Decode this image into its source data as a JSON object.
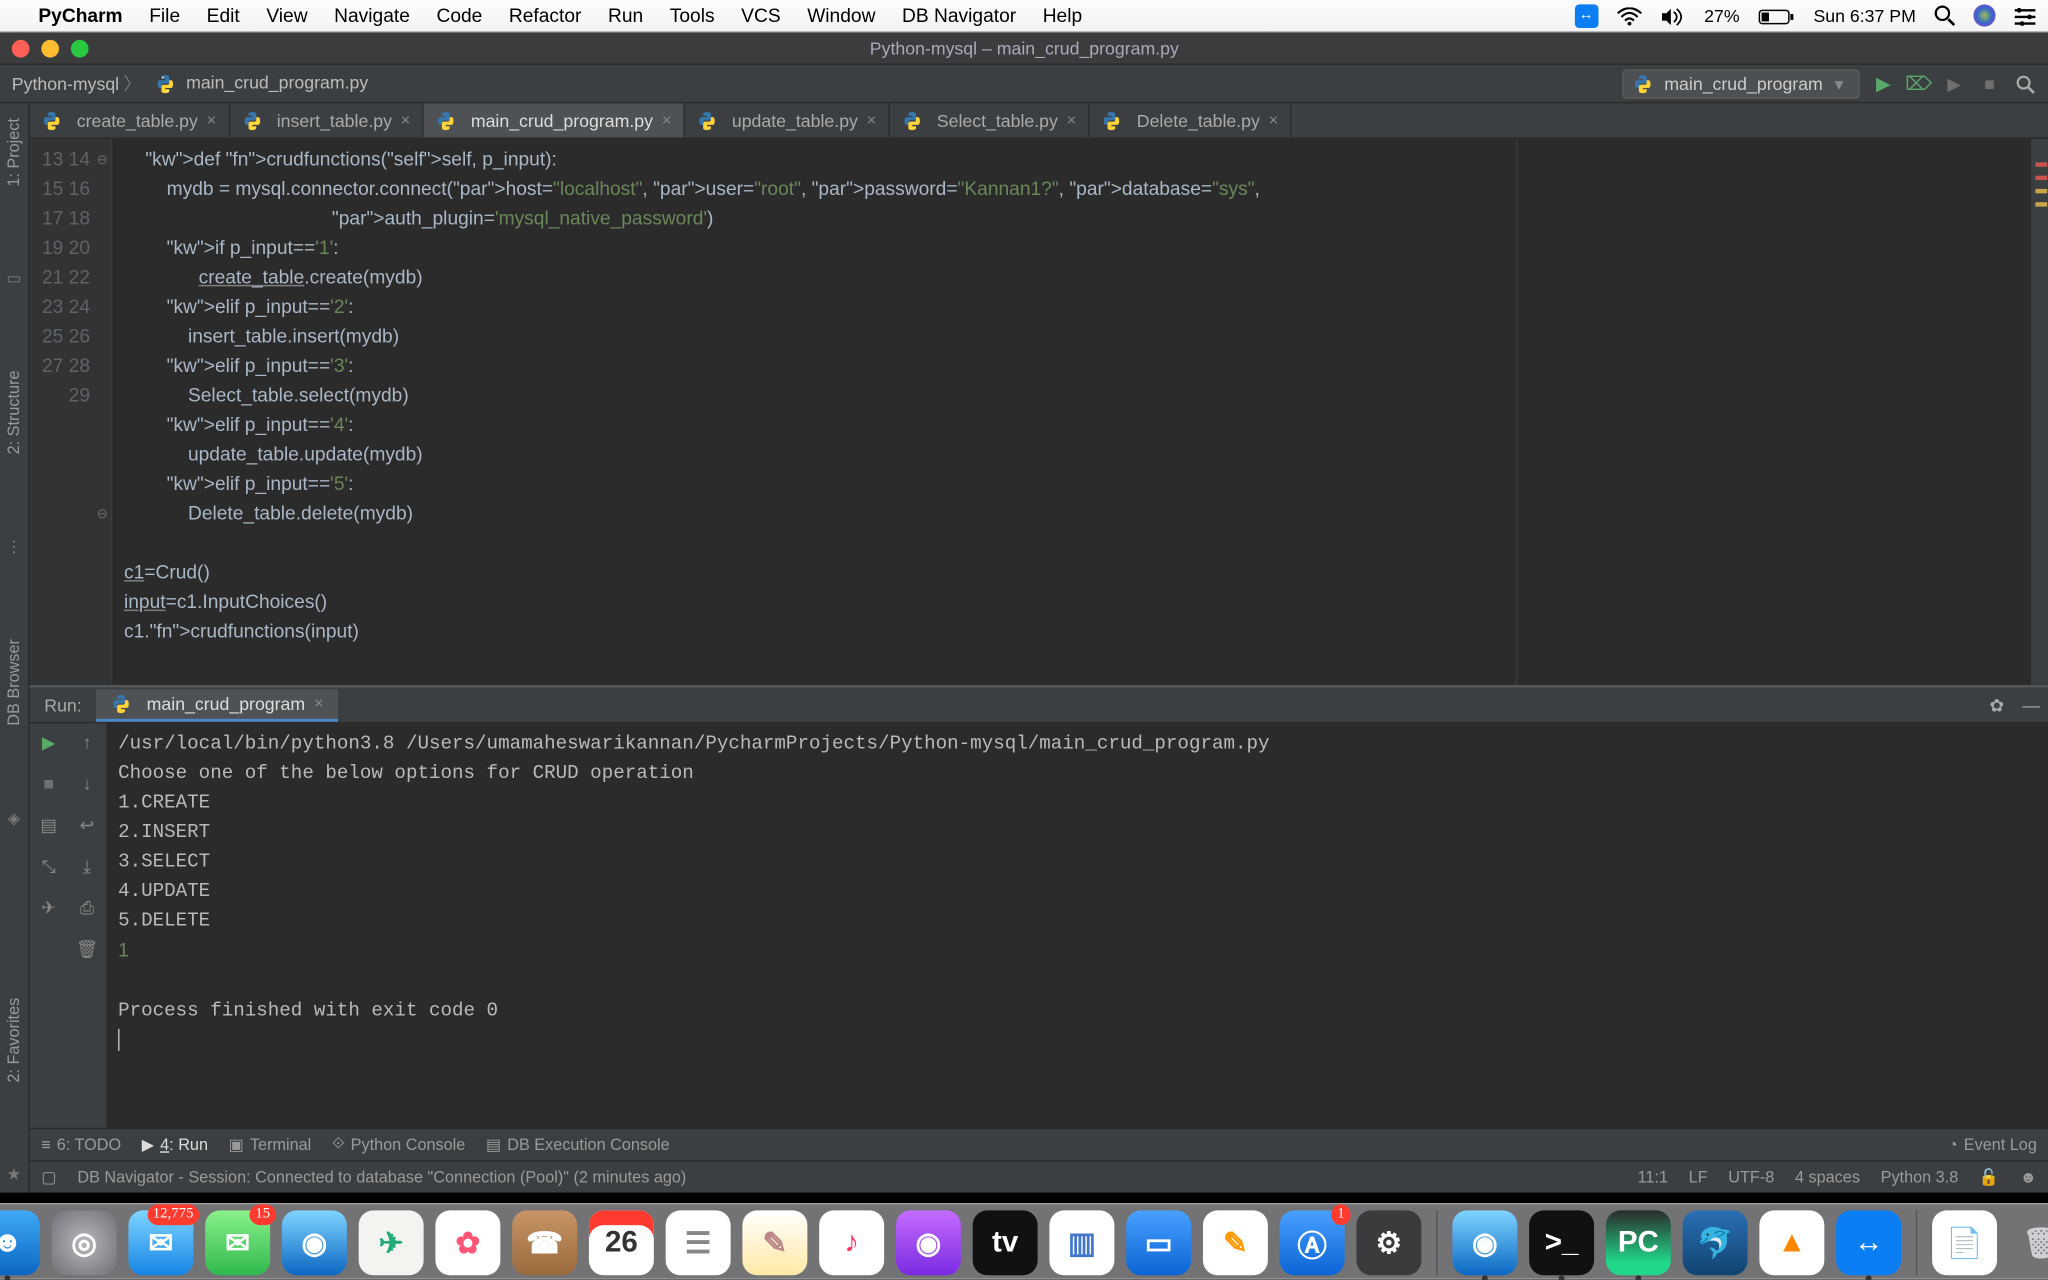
{
  "mac": {
    "app": "PyCharm",
    "menus": [
      "File",
      "Edit",
      "View",
      "Navigate",
      "Code",
      "Refactor",
      "Run",
      "Tools",
      "VCS",
      "Window",
      "DB Navigator",
      "Help"
    ],
    "battery_pct": "27%",
    "clock": "Sun 6:37 PM"
  },
  "window": {
    "title": "Python-mysql – main_crud_program.py",
    "breadcrumb_project": "Python-mysql",
    "breadcrumb_file": "main_crud_program.py",
    "run_config": "main_crud_program"
  },
  "left_tabs": [
    "1: Project",
    "2: Structure",
    "DB Browser",
    "2: Favorites"
  ],
  "tabs": [
    {
      "label": "create_table.py"
    },
    {
      "label": "insert_table.py"
    },
    {
      "label": "main_crud_program.py",
      "active": true
    },
    {
      "label": "update_table.py"
    },
    {
      "label": "Select_table.py"
    },
    {
      "label": "Delete_table.py"
    }
  ],
  "editor": {
    "first_line_no": 13,
    "lines": [
      "    def crudfunctions(self, p_input):",
      "        mydb = mysql.connector.connect(host=\"localhost\", user=\"root\", password=\"Kannan1?\", database=\"sys\",",
      "                                       auth_plugin='mysql_native_password')",
      "        if p_input=='1':",
      "              create_table.create(mydb)",
      "        elif p_input=='2':",
      "            insert_table.insert(mydb)",
      "        elif p_input=='3':",
      "            Select_table.select(mydb)",
      "        elif p_input=='4':",
      "            update_table.update(mydb)",
      "        elif p_input=='5':",
      "            Delete_table.delete(mydb)",
      "",
      "c1=Crud()",
      "input=c1.InputChoices()",
      "c1.crudfunctions(input)"
    ]
  },
  "run": {
    "label": "Run:",
    "tab": "main_crud_program",
    "lines": [
      "/usr/local/bin/python3.8 /Users/umamaheswarikannan/PycharmProjects/Python-mysql/main_crud_program.py",
      "Choose one of the below options for CRUD operation",
      "1.CREATE",
      "2.INSERT",
      "3.SELECT",
      "4.UPDATE",
      "5.DELETE"
    ],
    "input": "1",
    "exit": "Process finished with exit code 0"
  },
  "toolwin": [
    {
      "icon": "≡",
      "label": "6: TODO"
    },
    {
      "icon": "▶",
      "label": "4: Run",
      "active": true
    },
    {
      "icon": "▣",
      "label": "Terminal"
    },
    {
      "icon": "⟐",
      "label": "Python Console"
    },
    {
      "icon": "▤",
      "label": "DB Execution Console"
    }
  ],
  "toolwin_right": "Event Log",
  "status": {
    "msg": "DB Navigator - Session: Connected to database \"Connection (Pool)\" (2 minutes ago)",
    "pos": "11:1",
    "eol": "LF",
    "enc": "UTF-8",
    "indent": "4 spaces",
    "sdk": "Python 3.8"
  },
  "dock": [
    {
      "name": "finder",
      "bg": "linear-gradient(#3fa9f5,#0b67c2)",
      "glyph": "☻",
      "running": true
    },
    {
      "name": "launchpad",
      "bg": "radial-gradient(#b8b8bd,#6e6e74)",
      "glyph": "◎"
    },
    {
      "name": "mail",
      "bg": "linear-gradient(#7fd4ff,#1585e6)",
      "glyph": "✉",
      "badge": "12,775"
    },
    {
      "name": "messages",
      "bg": "linear-gradient(#8af08a,#2fb94e)",
      "glyph": "✉",
      "badge": "15"
    },
    {
      "name": "safari",
      "bg": "linear-gradient(#7fd4ff,#0b67c2)",
      "glyph": "◉"
    },
    {
      "name": "maps",
      "bg": "#f3f3ef",
      "glyph": "✈",
      "gc": "#2a7"
    },
    {
      "name": "photos",
      "bg": "#fff",
      "glyph": "✿",
      "gc": "#f57"
    },
    {
      "name": "contacts",
      "bg": "linear-gradient(#c79565,#9a6a3d)",
      "glyph": "☎"
    },
    {
      "name": "calendar",
      "bg": "#fff",
      "glyph": "26",
      "gc": "#333",
      "top": "#ff3b30"
    },
    {
      "name": "reminders",
      "bg": "#fff",
      "glyph": "☰",
      "gc": "#888"
    },
    {
      "name": "notes",
      "bg": "linear-gradient(#fff,#ffe9a6)",
      "glyph": "✎",
      "gc": "#b88"
    },
    {
      "name": "music",
      "bg": "#fff",
      "glyph": "♪",
      "gc": "#f36"
    },
    {
      "name": "podcasts",
      "bg": "linear-gradient(#c46bff,#7a2be2)",
      "glyph": "◉"
    },
    {
      "name": "tv",
      "bg": "#111",
      "glyph": "tv",
      "gc": "#fff"
    },
    {
      "name": "numbers",
      "bg": "#fff",
      "glyph": "▥",
      "gc": "#47c"
    },
    {
      "name": "keynote",
      "bg": "linear-gradient(#4aa0ff,#0a64d4)",
      "glyph": "▭"
    },
    {
      "name": "pages",
      "bg": "#fff",
      "glyph": "✎",
      "gc": "#f90"
    },
    {
      "name": "appstore",
      "bg": "linear-gradient(#4aa0ff,#0a64d4)",
      "glyph": "Ⓐ",
      "badge": "1"
    },
    {
      "name": "settings",
      "bg": "#3b3b3d",
      "glyph": "⚙"
    },
    {
      "name": "sep"
    },
    {
      "name": "safari2",
      "bg": "linear-gradient(#7fd4ff,#0b67c2)",
      "glyph": "◉",
      "running": true
    },
    {
      "name": "terminal",
      "bg": "#111",
      "glyph": ">_",
      "running": true
    },
    {
      "name": "pycharm",
      "bg": "linear-gradient(#2b2b2b,#21d789 80%)",
      "glyph": "PC",
      "running": true,
      "gc": "#fff"
    },
    {
      "name": "mysql",
      "bg": "linear-gradient(#2a6fb5,#11436f)",
      "glyph": "🐬"
    },
    {
      "name": "vlc",
      "bg": "#fff",
      "glyph": "▲",
      "gc": "#f80"
    },
    {
      "name": "teamviewer",
      "bg": "#0a7ef2",
      "glyph": "↔",
      "running": true
    },
    {
      "name": "sep"
    },
    {
      "name": "doc",
      "bg": "#fff",
      "glyph": "📄",
      "gc": "#555"
    },
    {
      "name": "trash",
      "bg": "transparent",
      "glyph": "🗑",
      "gc": "#cfcfd4"
    }
  ]
}
